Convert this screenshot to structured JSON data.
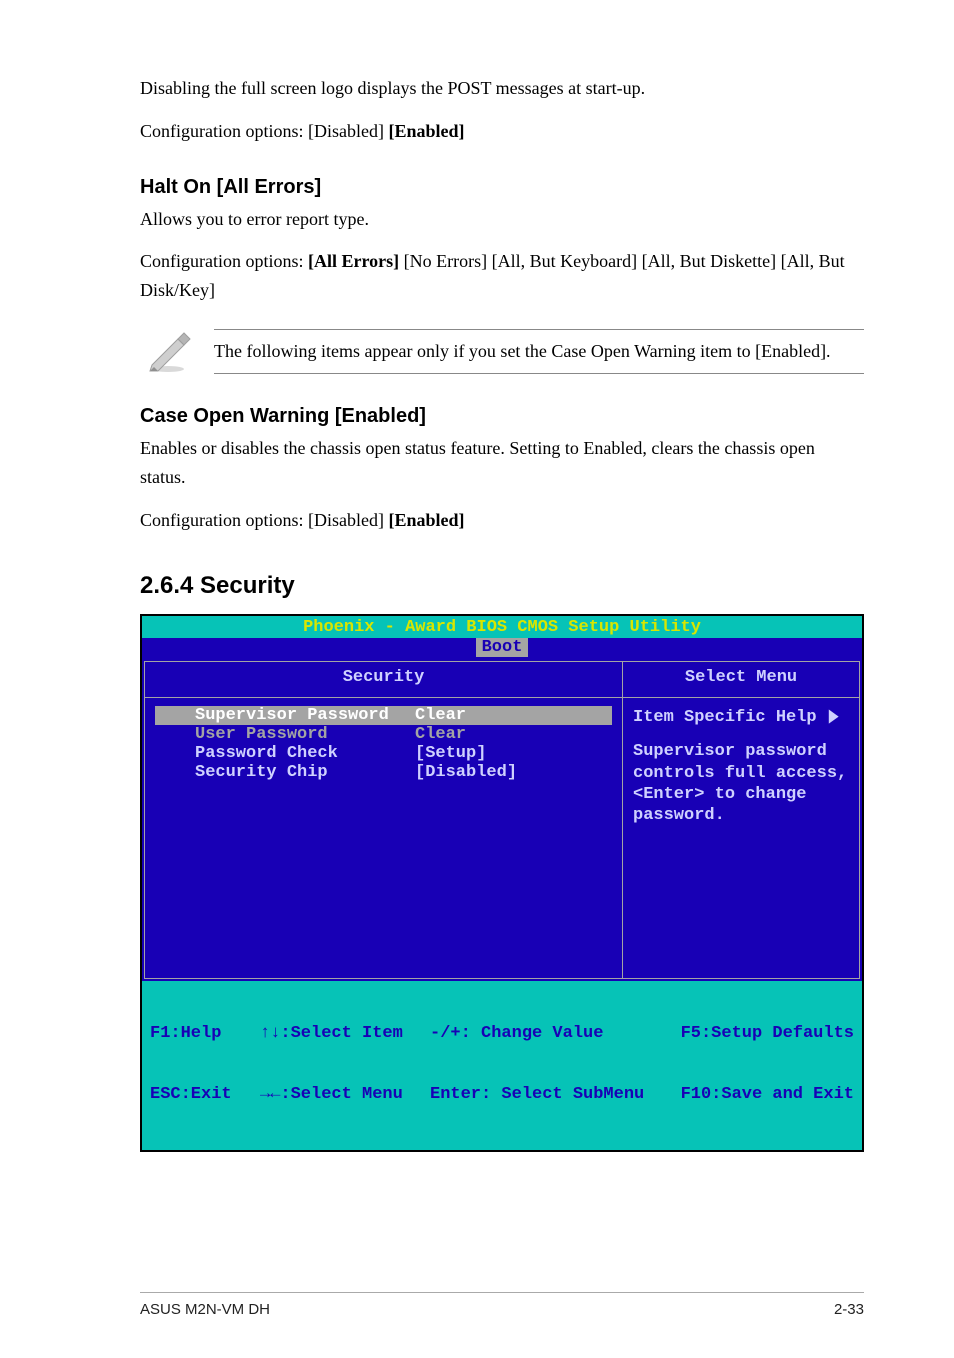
{
  "para1": "Disabling the full screen logo displays the POST messages at start-up.",
  "para2_prefix": "Configuration options: [Disabled] ",
  "para2_bold": "[Enabled]",
  "halt_head": "Halt On [All Errors]",
  "halt_body": "Allows you to error report type.",
  "halt_opts_prefix": "Configuration options: ",
  "halt_opts_bold": "[All Errors]",
  "halt_opts_suffix": " [No Errors] [All, But Keyboard] [All, But Diskette] [All, But Disk/Key]",
  "note_text": "The following items appear only if you set the Case Open Warning item to [Enabled].",
  "case_head": "Case Open Warning [Enabled]",
  "case_body": "Enables or disables the chassis open status feature. Setting to Enabled, clears the chassis open status.",
  "case_opts_prefix": "Configuration options: [Disabled] ",
  "case_opts_bold": "[Enabled]",
  "sec_heading": "2.6.4 Security",
  "bios": {
    "title": "Phoenix - Award BIOS CMOS Setup Utility",
    "tab": "Boot",
    "left_head": "Security",
    "right_head": "Select Menu",
    "rows": [
      {
        "label": "Supervisor Password",
        "value": "Clear",
        "variant": "hilite"
      },
      {
        "label": "User Password",
        "value": "Clear",
        "variant": "user"
      },
      {
        "label": "Password Check",
        "value": "[Setup]",
        "variant": ""
      },
      {
        "label": "Security Chip",
        "value": "[Disabled]",
        "variant": ""
      }
    ],
    "help_title": "Item Specific Help",
    "help_arrow": "▶",
    "help_body": "Supervisor password controls full access, <Enter> to change password.",
    "footer": {
      "r1c1": "F1:Help",
      "r1c2": "↑↓:Select Item",
      "r1c3": "-/+: Change Value",
      "r1c4": "F5:Setup Defaults",
      "r2c1": "ESC:Exit",
      "r2c2": "→←:Select Menu",
      "r2c3": "Enter: Select SubMenu",
      "r2c4": "F10:Save and Exit"
    }
  },
  "footer_left": "ASUS M2N-VM DH",
  "footer_right": "2-33"
}
